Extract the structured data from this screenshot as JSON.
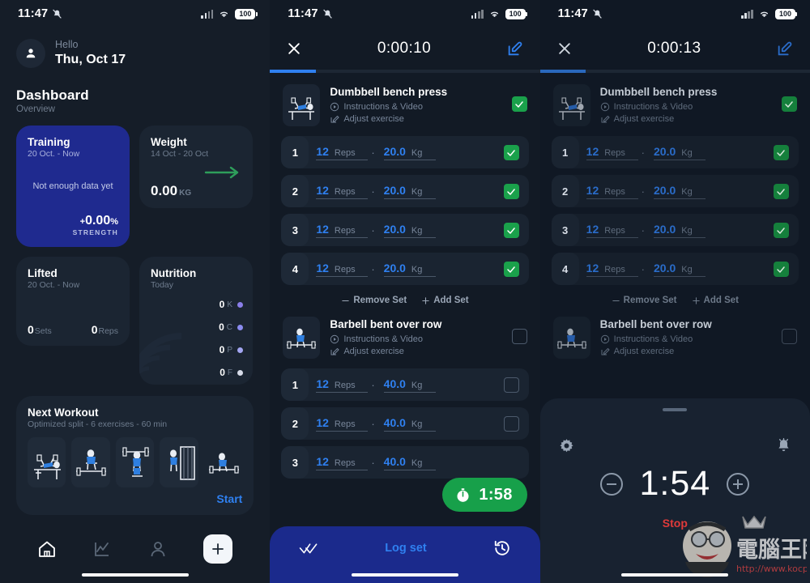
{
  "statusbar": {
    "time": "11:47",
    "battery": "100",
    "mute_icon": "bell-muted-icon",
    "wifi_icon": "wifi-icon",
    "signal_icon": "signal-bars-icon"
  },
  "screen1": {
    "greeting_label": "Hello",
    "date": "Thu, Oct 17",
    "avatar_icon": "person-icon",
    "section_title": "Dashboard",
    "section_sub": "Overview",
    "cards": {
      "training": {
        "title": "Training",
        "range": "20 Oct. - Now",
        "empty_message": "Not enough data yet",
        "delta_sign": "+",
        "delta_value": "0.00",
        "delta_unit": "%",
        "metric_label": "STRENGTH",
        "bg": "#1f2a8f"
      },
      "weight": {
        "title": "Weight",
        "range": "14 Oct - 20 Oct",
        "value": "0.00",
        "unit": "KG",
        "trend_icon": "arrow-right-icon",
        "trend_color": "#2e9e5b"
      },
      "lifted": {
        "title": "Lifted",
        "range": "20 Oct. - Now",
        "sets_value": "0",
        "sets_label": "Sets",
        "reps_value": "0",
        "reps_label": "Reps"
      },
      "nutrition": {
        "title": "Nutrition",
        "range": "Today",
        "macros": [
          {
            "value": "0",
            "key": "K",
            "color": "#8a7ee8"
          },
          {
            "value": "0",
            "key": "C",
            "color": "#8b8cf0"
          },
          {
            "value": "0",
            "key": "P",
            "color": "#a3a6f2"
          },
          {
            "value": "0",
            "key": "F",
            "color": "#d7dbe8"
          }
        ]
      }
    },
    "next_workout": {
      "title": "Next Workout",
      "sub": "Optimized split - 6 exercises - 60 min",
      "start_label": "Start",
      "thumbs": [
        "bench-press-thumb",
        "deadlift-thumb",
        "front-squat-thumb",
        "cable-machine-thumb",
        "barbell-row-thumb"
      ]
    },
    "nav": [
      {
        "name": "home",
        "icon": "home-icon",
        "active": true
      },
      {
        "name": "stats",
        "icon": "chart-line-icon",
        "active": false
      },
      {
        "name": "profile",
        "icon": "person-icon",
        "active": false
      },
      {
        "name": "add",
        "icon": "plus-icon",
        "active": false
      }
    ]
  },
  "screen2": {
    "close_icon": "close-x-icon",
    "elapsed": "0:00:10",
    "edit_icon": "edit-pencil-icon",
    "progress_pct": 17,
    "exercises": [
      {
        "name": "Dumbbell bench press",
        "instructions_label": "Instructions & Video",
        "adjust_label": "Adjust exercise",
        "thumb": "bench-press-thumb",
        "completed": true,
        "sets": [
          {
            "no": "1",
            "reps": "12",
            "reps_unit": "Reps",
            "weight": "20.0",
            "weight_unit": "Kg",
            "done": true
          },
          {
            "no": "2",
            "reps": "12",
            "reps_unit": "Reps",
            "weight": "20.0",
            "weight_unit": "Kg",
            "done": true
          },
          {
            "no": "3",
            "reps": "12",
            "reps_unit": "Reps",
            "weight": "20.0",
            "weight_unit": "Kg",
            "done": true
          },
          {
            "no": "4",
            "reps": "12",
            "reps_unit": "Reps",
            "weight": "20.0",
            "weight_unit": "Kg",
            "done": true
          }
        ],
        "remove_label": "Remove Set",
        "add_label": "Add Set"
      },
      {
        "name": "Barbell bent over row",
        "instructions_label": "Instructions & Video",
        "adjust_label": "Adjust exercise",
        "thumb": "barbell-row-thumb",
        "completed": false,
        "sets": [
          {
            "no": "1",
            "reps": "12",
            "reps_unit": "Reps",
            "weight": "40.0",
            "weight_unit": "Kg",
            "done": false
          },
          {
            "no": "2",
            "reps": "12",
            "reps_unit": "Reps",
            "weight": "40.0",
            "weight_unit": "Kg",
            "done": false
          },
          {
            "no": "3",
            "reps": "12",
            "reps_unit": "Reps",
            "weight": "40.0",
            "weight_unit": "Kg",
            "done": false
          }
        ]
      }
    ],
    "rest_pill": {
      "time": "1:58",
      "icon": "stopwatch-icon",
      "color": "#17a04a"
    },
    "logbar": {
      "label": "Log set",
      "left_icon": "double-check-icon",
      "right_icon": "history-clock-icon",
      "color": "#1b2a8c"
    }
  },
  "screen3": {
    "close_icon": "close-x-icon",
    "elapsed": "0:00:13",
    "edit_icon": "edit-pencil-icon",
    "progress_pct": 17,
    "exercises": [
      {
        "name": "Dumbbell bench press",
        "instructions_label": "Instructions & Video",
        "adjust_label": "Adjust exercise",
        "thumb": "bench-press-thumb",
        "completed": true,
        "sets": [
          {
            "no": "1",
            "reps": "12",
            "reps_unit": "Reps",
            "weight": "20.0",
            "weight_unit": "Kg",
            "done": true
          },
          {
            "no": "2",
            "reps": "12",
            "reps_unit": "Reps",
            "weight": "20.0",
            "weight_unit": "Kg",
            "done": true
          },
          {
            "no": "3",
            "reps": "12",
            "reps_unit": "Reps",
            "weight": "20.0",
            "weight_unit": "Kg",
            "done": true
          },
          {
            "no": "4",
            "reps": "12",
            "reps_unit": "Reps",
            "weight": "20.0",
            "weight_unit": "Kg",
            "done": true
          }
        ],
        "remove_label": "Remove Set",
        "add_label": "Add Set"
      },
      {
        "name": "Barbell bent over row",
        "instructions_label": "Instructions & Video",
        "adjust_label": "Adjust exercise",
        "thumb": "barbell-row-thumb",
        "completed": false,
        "sets": []
      }
    ],
    "rest_sheet": {
      "settings_icon": "gear-icon",
      "alarm_icon": "bell-icon",
      "minus_icon": "minus-circle-icon",
      "plus_icon": "plus-circle-icon",
      "time": "1:54",
      "stop_label": "Stop",
      "stop_color": "#e03a3a"
    }
  },
  "watermark": {
    "text": "電腦王阿達",
    "url": "http://www.kocpc.com.tw"
  }
}
